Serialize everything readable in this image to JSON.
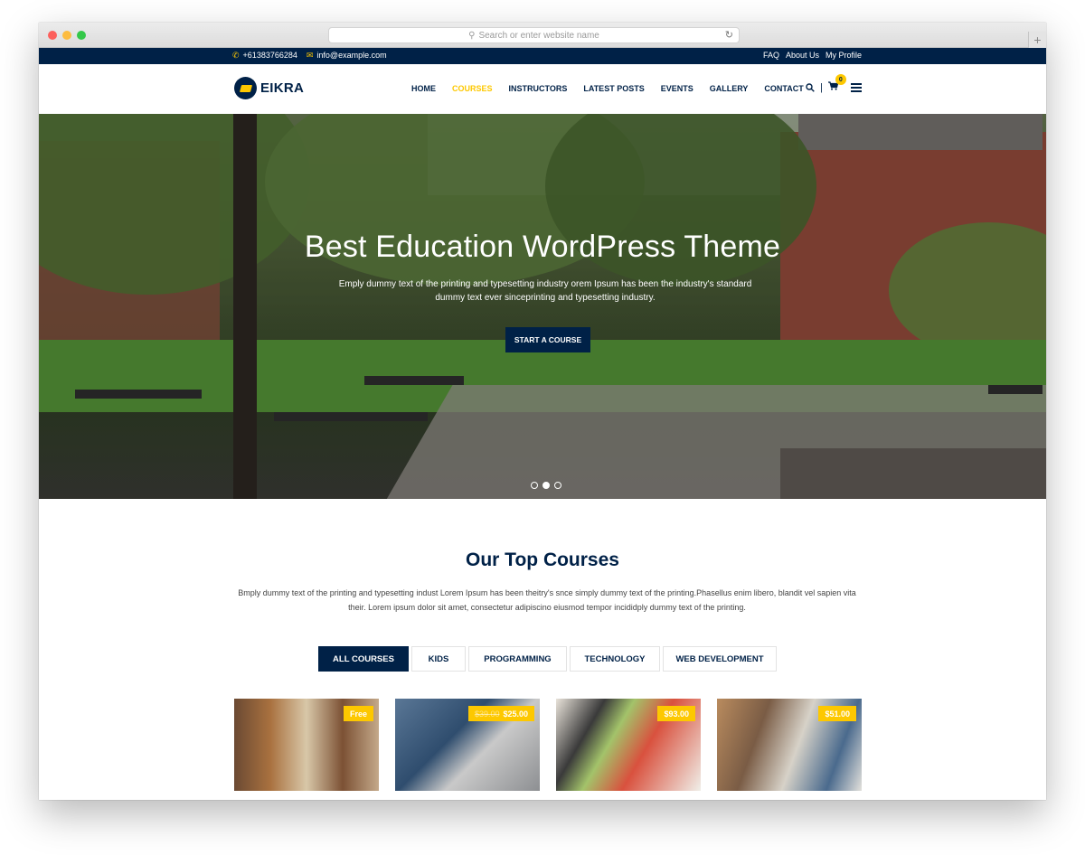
{
  "browser": {
    "url_placeholder": "Search or enter website name",
    "new_tab_symbol": "+",
    "reload_symbol": "↻"
  },
  "topbar": {
    "phone": "+61383766284",
    "email": "info@example.com",
    "links": [
      "FAQ",
      "About Us",
      "My Profile"
    ]
  },
  "nav": {
    "logo_text": "EIKRA",
    "items": [
      "HOME",
      "COURSES",
      "INSTRUCTORS",
      "LATEST POSTS",
      "EVENTS",
      "GALLERY",
      "CONTACT"
    ],
    "active_item": "COURSES",
    "cart_count": "0",
    "icons": [
      "search-icon",
      "cart-icon",
      "menu-icon"
    ]
  },
  "hero": {
    "title": "Best Education WordPress Theme",
    "subtitle": "Emply dummy text of the printing and typesetting industry orem Ipsum has been the industry's standard dummy text ever sinceprinting and typesetting industry.",
    "button": "START A COURSE",
    "slides": 3,
    "active_slide": 2
  },
  "courses": {
    "title": "Our Top Courses",
    "description": "Bmply dummy text of the printing and typesetting indust Lorem Ipsum has been theitry's snce simply dummy text of the printing.Phasellus enim libero, blandit vel sapien vita their. Lorem ipsum dolor sit amet, consectetur adipiscino eiusmod tempor incididply dummy text of the printing.",
    "tabs": [
      "ALL COURSES",
      "KIDS",
      "PROGRAMMING",
      "TECHNOLOGY",
      "WEB DEVELOPMENT"
    ],
    "active_tab": "ALL COURSES",
    "cards": [
      {
        "price": "Free",
        "old_price": ""
      },
      {
        "price": "$25.00",
        "old_price": "$39.00"
      },
      {
        "price": "$93.00",
        "old_price": ""
      },
      {
        "price": "$51.00",
        "old_price": ""
      }
    ]
  },
  "colors": {
    "primary": "#002147",
    "accent": "#fdc800"
  }
}
